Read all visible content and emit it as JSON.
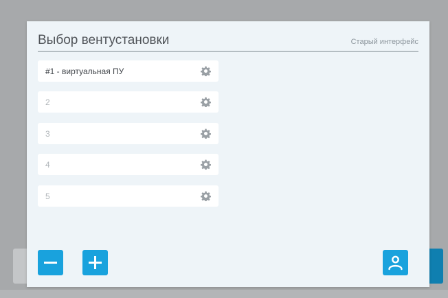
{
  "modal": {
    "title": "Выбор вентустановки",
    "old_interface_link": "Старый интерфейс"
  },
  "units": [
    {
      "label": "#1 - виртуальная ПУ",
      "active": true
    },
    {
      "label": "2",
      "active": false
    },
    {
      "label": "3",
      "active": false
    },
    {
      "label": "4",
      "active": false
    },
    {
      "label": "5",
      "active": false
    }
  ],
  "icons": {
    "unit_settings": "gear-icon",
    "remove": "minus-icon",
    "add": "plus-icon",
    "user": "user-icon"
  },
  "colors": {
    "accent": "#19a2dd",
    "modal_background": "#eef4f8",
    "overlay": "#a7a9ab",
    "gear": "#9aa0a5"
  }
}
